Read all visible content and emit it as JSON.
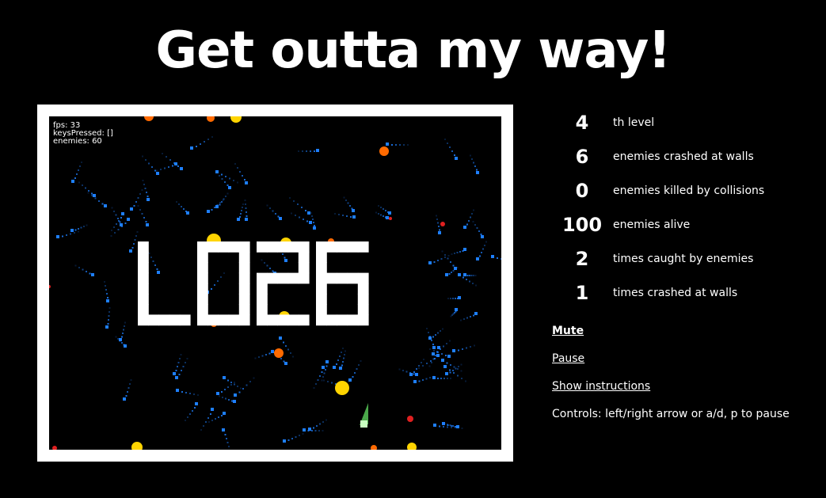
{
  "title": "Get outta my way!",
  "debug": {
    "fps": "fps: 33",
    "keys": "keysPressed: []",
    "enemies": "enemies: 60"
  },
  "game": {
    "banner": "L026",
    "colors": {
      "frame": "#ffffff",
      "background": "#000000",
      "enemy": "#1e7fff",
      "orb_orange": "#ff6a00",
      "orb_yellow": "#ffd400",
      "spark_red": "#e02020",
      "player": "#c8ffc0"
    }
  },
  "stats": [
    {
      "value": "4",
      "label": "th level"
    },
    {
      "value": "6",
      "label": "enemies crashed at walls"
    },
    {
      "value": "0",
      "label": "enemies killed by collisions"
    },
    {
      "value": "100",
      "label": "enemies alive"
    },
    {
      "value": "2",
      "label": "times caught by enemies"
    },
    {
      "value": "1",
      "label": "times crashed at walls"
    }
  ],
  "links": {
    "mute": "Mute",
    "pause": "Pause",
    "instructions": "Show instructions"
  },
  "controls": "Controls: left/right arrow or a/d, p to pause"
}
